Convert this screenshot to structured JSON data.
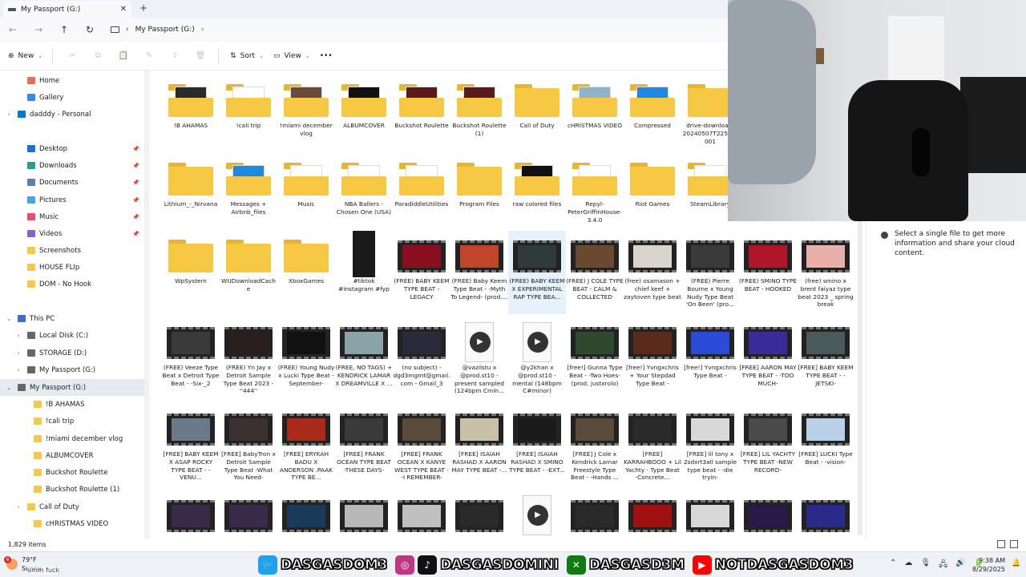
{
  "tab": {
    "title": "My Passport (G:)",
    "close": "✕",
    "new_tab": "+"
  },
  "address": {
    "back": "←",
    "forward": "→",
    "up": "↑",
    "refresh": "↻",
    "crumb": "My Passport (G:)",
    "chevron": "›"
  },
  "commands": {
    "new_label": "New",
    "sort_label": "Sort",
    "view_label": "View",
    "more": "•••",
    "new_icon": "⊕",
    "sort_icon": "⇅",
    "view_icon": "▭",
    "dropdown": "⌄"
  },
  "sidebar": {
    "items": [
      {
        "label": "Home",
        "icon": "home-icon"
      },
      {
        "label": "Gallery",
        "icon": "gallery-icon"
      },
      {
        "label": "dadddy - Personal",
        "icon": "cloud-icon",
        "expand": "›"
      },
      {
        "label": "Desktop",
        "icon": "desktop-icon",
        "pin": "📌"
      },
      {
        "label": "Downloads",
        "icon": "downloads-icon",
        "pin": "📌"
      },
      {
        "label": "Documents",
        "icon": "documents-icon",
        "pin": "📌"
      },
      {
        "label": "Pictures",
        "icon": "pictures-icon",
        "pin": "📌"
      },
      {
        "label": "Music",
        "icon": "music-icon",
        "pin": "📌"
      },
      {
        "label": "Videos",
        "icon": "videos-icon",
        "pin": "📌"
      },
      {
        "label": "Screenshots",
        "icon": "folder-icon"
      },
      {
        "label": "HOUSE FLIp",
        "icon": "folder-icon"
      },
      {
        "label": "DOM - No Hook",
        "icon": "folder-icon"
      },
      {
        "label": "This PC",
        "icon": "pc-icon",
        "expand": "⌄"
      },
      {
        "label": "Local Disk (C:)",
        "icon": "drive-icon",
        "expand": "›"
      },
      {
        "label": "STORAGE (D:)",
        "icon": "drive-icon",
        "expand": "›"
      },
      {
        "label": "My Passport (G:)",
        "icon": "drive-icon",
        "expand": "›"
      },
      {
        "label": "My Passport (G:)",
        "icon": "drive-icon",
        "expand": "⌄"
      },
      {
        "label": "!B AHAMAS",
        "icon": "folder-icon"
      },
      {
        "label": "!cali trip",
        "icon": "folder-icon"
      },
      {
        "label": "!miami december vlog",
        "icon": "folder-icon"
      },
      {
        "label": "ALBUMCOVER",
        "icon": "folder-icon"
      },
      {
        "label": "Buckshot Roulette",
        "icon": "folder-icon"
      },
      {
        "label": "Buckshot Roulette (1)",
        "icon": "folder-icon"
      },
      {
        "label": "Call of Duty",
        "icon": "folder-icon",
        "expand": "›"
      },
      {
        "label": "cHRISTMAS VIDEO",
        "icon": "folder-icon"
      }
    ]
  },
  "files": [
    {
      "name": "!B AHAMAS",
      "kind": "folder",
      "preview": "#2a2a2a"
    },
    {
      "name": "!cali trip",
      "kind": "folder",
      "preview": "#ffffff"
    },
    {
      "name": "!miami december vlog",
      "kind": "folder",
      "preview": "#6b4a3a"
    },
    {
      "name": "ALBUMCOVER",
      "kind": "folder",
      "preview": "#111111"
    },
    {
      "name": "Buckshot Roulette",
      "kind": "folder",
      "preview": "#5a1a1a"
    },
    {
      "name": "Buckshot Roulette (1)",
      "kind": "folder",
      "preview": "#5a1a1a"
    },
    {
      "name": "Call of Duty",
      "kind": "folder"
    },
    {
      "name": "cHRISTMAS VIDEO",
      "kind": "folder",
      "preview": "#8fb3c9"
    },
    {
      "name": "Compressed",
      "kind": "folder",
      "preview": "#1e88e5"
    },
    {
      "name": "drive-download-20240507T2259Z-001",
      "kind": "folder"
    },
    {
      "name": "Lithium_-_Nirvana",
      "kind": "folder"
    },
    {
      "name": "Messages + Airbnb_files",
      "kind": "folder",
      "preview": "#1e88e5"
    },
    {
      "name": "Music",
      "kind": "folder",
      "preview": "#ffffff"
    },
    {
      "name": "NBA Ballers - Chosen One (USA)",
      "kind": "folder",
      "preview": "#ffffff"
    },
    {
      "name": "ParadiddleUtilities",
      "kind": "folder",
      "preview": "#ffffff"
    },
    {
      "name": "Program Files",
      "kind": "folder"
    },
    {
      "name": "raw colored files",
      "kind": "folder",
      "preview": "#111111"
    },
    {
      "name": "Repyl-PeterGriffinHouse-3.4.0",
      "kind": "folder",
      "preview": "#ffffff"
    },
    {
      "name": "Riot Games",
      "kind": "folder"
    },
    {
      "name": "SteamLibrary",
      "kind": "folder",
      "preview": "#ffffff"
    },
    {
      "name": "WpSystem",
      "kind": "folder"
    },
    {
      "name": "WUDownloadCache",
      "kind": "folder"
    },
    {
      "name": "XboxGames",
      "kind": "folder"
    },
    {
      "name": "#tiktok #instagram #fyp",
      "kind": "image",
      "preview": "#1a1a1a"
    },
    {
      "name": "(FREE) BABY KEEM TYPE BEAT - LEGACY",
      "kind": "video",
      "preview": "#8a1020"
    },
    {
      "name": "(FREE) Baby Keem Type Beat - -Myth To Legend- (prod....",
      "kind": "video",
      "preview": "#c0462a"
    },
    {
      "name": "(FREE) BABY KEEM X EXPERIMENTAL RAP TYPE BEA...",
      "kind": "video",
      "preview": "#2f3a3a",
      "selected": true
    },
    {
      "name": "(FREE) J COLE TYPE BEAT - CALM & COLLECTED",
      "kind": "video",
      "preview": "#6a4a2e"
    },
    {
      "name": "(free) osamason + chief keef + zaytoven type beat",
      "kind": "video",
      "preview": "#d8d4cc"
    },
    {
      "name": "(FREE) Pierre Bourne x Young Nudy Type Beat 'On Been' (pro...",
      "kind": "video",
      "preview": "#3a3a3a"
    },
    {
      "name": "(FREE) SMINO TYPE BEAT - HOOKED",
      "kind": "video",
      "preview": "#b0162a"
    },
    {
      "name": "(free) smino x brent faiyaz type beat 2023 _ spring break",
      "kind": "video",
      "preview": "#e8b0a8"
    },
    {
      "name": "(FREE) Veeze Type Beat x Detroit Type Beat - -Six-_2",
      "kind": "video",
      "preview": "#3a3a3a"
    },
    {
      "name": "(FREE) Yn Jay x Detroit Sample Type Beat 2023 - ''444''",
      "kind": "video",
      "preview": "#2a1f1f"
    },
    {
      "name": "(FREE) Young Nudy x Lucki Type Beat -September-",
      "kind": "video",
      "preview": "#111111"
    },
    {
      "name": "(FREE, NO TAGS) + KENDRICK LAMAR X DREAMVILLE X ...",
      "kind": "video",
      "preview": "#8aa3a8"
    },
    {
      "name": "(no subject) - dgd3mgmt@gmail.com - Gmail_3",
      "kind": "video",
      "preview": "#2a2a3a"
    },
    {
      "name": "@vazilstu x @prod.st10 - present sampled (124bpm Cmin...",
      "kind": "audio"
    },
    {
      "name": "@y2khan x @prod.st10 - mental (148bpm C#minor)",
      "kind": "audio"
    },
    {
      "name": "[free!] Gunna Type Beat - -Two Hoes- (prod. justxrolo)",
      "kind": "video",
      "preview": "#2e4a2e"
    },
    {
      "name": "[free!] Yvngxchris + Your Stepdad Type Beat -",
      "kind": "video",
      "preview": "#5a2a1a"
    },
    {
      "name": "[free!] Yvngxchris Type Beat -",
      "kind": "video",
      "preview": "#2a4ad8"
    },
    {
      "name": "[FREE] AARON MAY TYPE BEAT - -TOO MUCH-",
      "kind": "video",
      "preview": "#3a2a9a"
    },
    {
      "name": "[FREE] BABY KEEM TYPE BEAT - -JETSKI-",
      "kind": "video",
      "preview": "#4a5a5a"
    },
    {
      "name": "[FREE] BABY KEEM X ASAP ROCKY TYPE BEAT - -VENU...",
      "kind": "video",
      "preview": "#6a7a8a"
    },
    {
      "name": "[FREE] BabyTron x Detroit Sample Type Beat -What You Need-",
      "kind": "video",
      "preview": "#3a3030"
    },
    {
      "name": "[FREE] ERYKAH BADU X ANDERSON .PAAK TYPE BE...",
      "kind": "video",
      "preview": "#a82a1a"
    },
    {
      "name": "[FREE] FRANK OCEAN TYPE BEAT -THESE DAYS-",
      "kind": "video",
      "preview": "#3a3a3a"
    },
    {
      "name": "[FREE] FRANK OCEAN X KANYE WEST TYPE BEAT - -I REMEMBER-",
      "kind": "video",
      "preview": "#5a4a3a"
    },
    {
      "name": "[FREE] ISAIAH RASHAD X AARON MAY TYPE BEAT -...",
      "kind": "video",
      "preview": "#c8c0a8"
    },
    {
      "name": "[FREE] ISAIAH RASHAD X SMINO TYPE BEAT - -EXT...",
      "kind": "video",
      "preview": "#1a1a1a"
    },
    {
      "name": "[FREE] J Cole x Kendrick Lamar Freestyle Type Beat - -Hands ...",
      "kind": "video",
      "preview": "#5a4a3a"
    },
    {
      "name": "[FREE] KARRAHBOOO + Lil Yachty - Type Beat -Concrete...",
      "kind": "video",
      "preview": "#2a2a2a"
    },
    {
      "name": "[FREE] lil tony x 2sdxrt3all sample type beat - -die tryin-",
      "kind": "video",
      "preview": "#d8d8d8"
    },
    {
      "name": "[FREE] LIL YACHTY TYPE BEAT -NEW RECORD-",
      "kind": "video",
      "preview": "#4a4a4a"
    },
    {
      "name": "[FREE] LUCKI Type Beat - -vision-",
      "kind": "video",
      "preview": "#b8d0e8"
    },
    {
      "name": "",
      "kind": "video",
      "preview": "#3a2a4a"
    },
    {
      "name": "",
      "kind": "video",
      "preview": "#3a2a4a"
    },
    {
      "name": "",
      "kind": "video",
      "preview": "#1a3a5a"
    },
    {
      "name": "",
      "kind": "video",
      "preview": "#b8b8b8"
    },
    {
      "name": "",
      "kind": "video",
      "preview": "#c0c0c0"
    },
    {
      "name": "",
      "kind": "video",
      "preview": "#2a2a2a"
    },
    {
      "name": "",
      "kind": "audio"
    },
    {
      "name": "",
      "kind": "video",
      "preview": "#2a2a2a"
    },
    {
      "name": "",
      "kind": "video",
      "preview": "#a01010"
    },
    {
      "name": "",
      "kind": "video",
      "preview": "#d8d8d8"
    },
    {
      "name": "",
      "kind": "video",
      "preview": "#2a1a4a"
    },
    {
      "name": "",
      "kind": "video",
      "preview": "#2a2a8a"
    }
  ],
  "details": {
    "message": "Select a single file to get more information and share your cloud content.",
    "icon": "info-icon"
  },
  "status": {
    "count": "1,829 items"
  },
  "taskbar": {
    "weather_temp": "79°F",
    "weather_desc": "Sunny",
    "weather_badge": "6",
    "caption": "umm fuck",
    "socials": [
      {
        "icon": "twitter-icon",
        "glyph": "🐦",
        "color": "#1da1f2",
        "handle": "DASGASDOM3"
      },
      {
        "icon": "instagram-icon",
        "glyph": "◎",
        "color": "#c13584",
        "handle": ""
      },
      {
        "icon": "tiktok-icon",
        "glyph": "♪",
        "color": "#111111",
        "handle": "DASGASDOMINI"
      },
      {
        "icon": "xbox-icon",
        "glyph": "✕",
        "color": "#107c10",
        "handle": "DASGASD3M"
      },
      {
        "icon": "youtube-icon",
        "glyph": "▶",
        "color": "#ff0000",
        "handle": "NOTDASGASDOM3"
      }
    ],
    "tray": [
      "⌃",
      "☁",
      "🎙",
      "🖧",
      "🔊",
      "🔋"
    ],
    "time": "9:38 AM",
    "date": "8/29/2025"
  }
}
